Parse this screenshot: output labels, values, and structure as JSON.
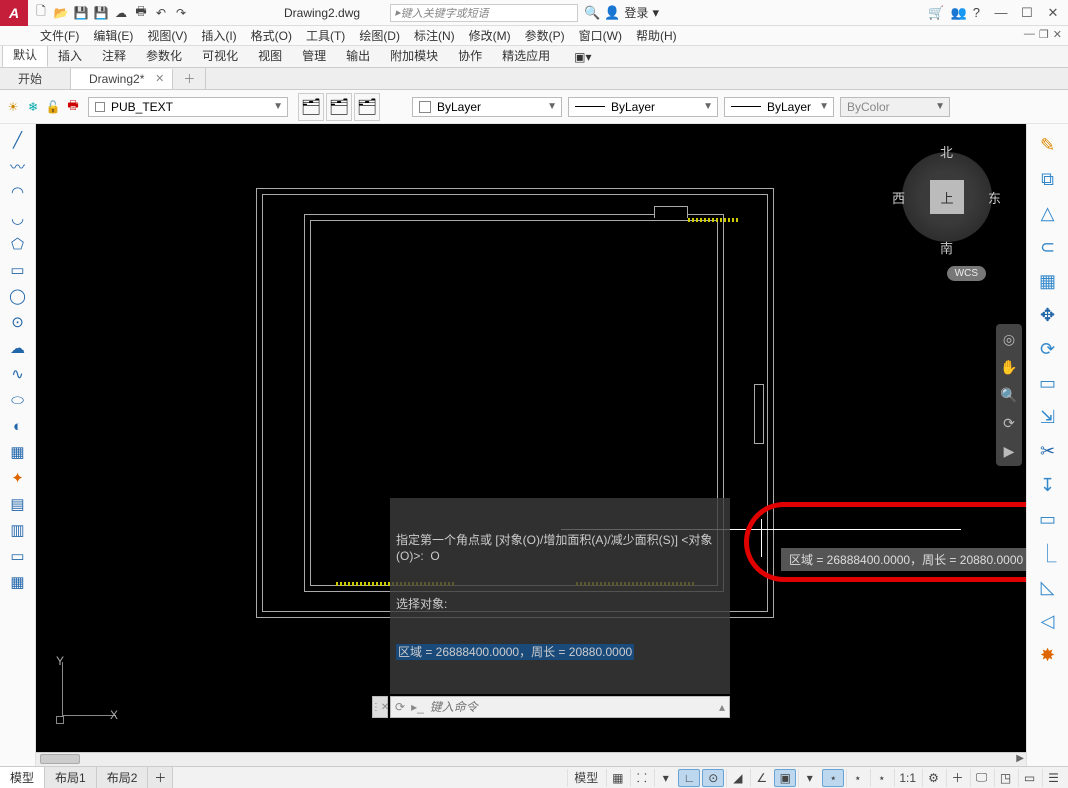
{
  "app": {
    "logo": "A",
    "title": "Drawing2.dwg",
    "search_placeholder": "键入关键字或短语",
    "login_label": "登录"
  },
  "menu": {
    "file": "文件(F)",
    "edit": "编辑(E)",
    "view": "视图(V)",
    "insert": "插入(I)",
    "format": "格式(O)",
    "tools": "工具(T)",
    "draw": "绘图(D)",
    "dimension": "标注(N)",
    "modify": "修改(M)",
    "param": "参数(P)",
    "window": "窗口(W)",
    "help": "帮助(H)"
  },
  "ribbon": {
    "default": "默认",
    "insert": "插入",
    "annotate": "注释",
    "parametric": "参数化",
    "visualize": "可视化",
    "view": "视图",
    "manage": "管理",
    "output": "输出",
    "addins": "附加模块",
    "collab": "协作",
    "featured": "精选应用"
  },
  "doctabs": {
    "start": "开始",
    "active": "Drawing2*"
  },
  "props": {
    "layer_name": "PUB_TEXT",
    "color": "ByLayer",
    "linetype": "ByLayer",
    "lineweight": "ByLayer",
    "plotstyle": "ByColor"
  },
  "viewcube": {
    "top": "上",
    "n": "北",
    "s": "南",
    "e": "东",
    "w": "西",
    "wcs": "WCS"
  },
  "tooltip": {
    "text": "区域 = 26888400.0000，周长 = 20880.0000"
  },
  "cmd": {
    "line1": "指定第一个角点或 [对象(O)/增加面积(A)/减少面积(S)] <对象(O)>:  O",
    "line2": "选择对象:",
    "line3": "区域 = 26888400.0000，周长 = 20880.0000",
    "placeholder": "键入命令"
  },
  "layouts": {
    "model": "模型",
    "layout1": "布局1",
    "layout2": "布局2"
  },
  "status": {
    "model_btn": "模型",
    "scale": "1:1"
  },
  "ucs": {
    "x": "X",
    "y": "Y"
  }
}
